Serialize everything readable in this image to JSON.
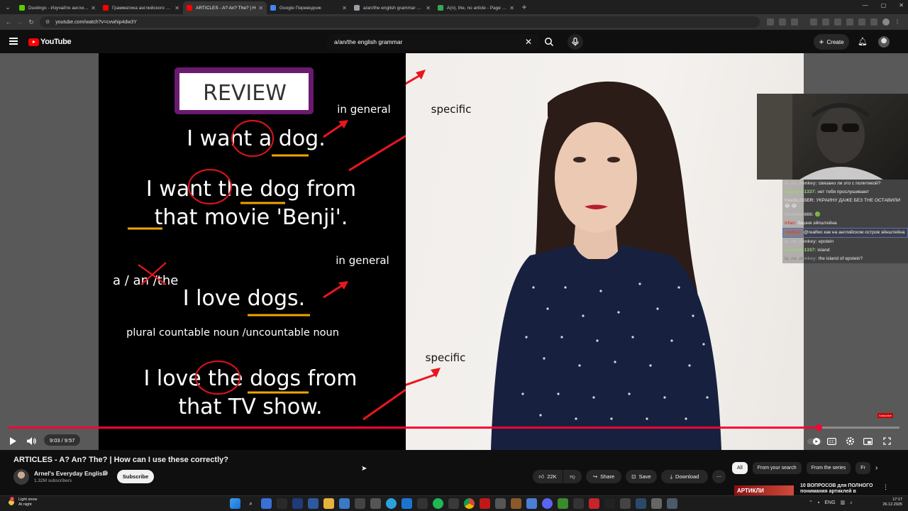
{
  "browser": {
    "tabs": [
      {
        "title": "Duolingo - Изучайте английск",
        "favicon_color": "#58cc02",
        "active": false
      },
      {
        "title": "Грамматика английского язы",
        "favicon_color": "#ff0000",
        "active": false
      },
      {
        "title": "ARTICLES - A? An? The? | H",
        "favicon_color": "#ff0000",
        "active": true
      },
      {
        "title": "Google Переводчик",
        "favicon_color": "#4285f4",
        "active": false
      },
      {
        "title": "a/an/the english grammar gam",
        "favicon_color": "#9aa0a6",
        "active": false
      },
      {
        "title": "A(n), the, no article - Page 3 of",
        "favicon_color": "#34a853",
        "active": false
      }
    ],
    "url": "youtube.com/watch?v=cvwhip4dw3Y"
  },
  "youtube": {
    "logo_text": "YouTube",
    "search_value": "a/an/the english grammar",
    "create_label": "Create"
  },
  "slide": {
    "review_title": "REVIEW",
    "sentence_1": "I want a dog.",
    "label_in_general_1": "in general",
    "label_specific_1": "specific",
    "sentence_2_line1": "I want the dog from",
    "sentence_2_line2": "that movie 'Benji'.",
    "a_an_the_prefix": "a / ",
    "a_an_the_struck": "an",
    "a_an_the_suffix": " /the",
    "label_in_general_2": "in general",
    "sentence_3": "I love dogs.",
    "noun_note": "plural countable noun /uncountable noun",
    "sentence_4_line1": "I love the dogs from",
    "sentence_4_line2": "that TV show.",
    "label_specific_2": "specific"
  },
  "overlay": {
    "chat": [
      {
        "user": "ia_ne_donkey:",
        "user_color": "#bfbfbf",
        "text": "связано ли это с политикой?",
        "highlight": false
      },
      {
        "user": "nudopac1337:",
        "user_color": "#9ad17a",
        "text": "нет тебя прослушивают",
        "highlight": false
      },
      {
        "user": "freeBLOGER:",
        "user_color": "#cfcfcf",
        "text": "УКРАИНУ ДАЖЕ БЕЗ THE ОСТАВИЛИ 😂 😂",
        "highlight": false
      },
      {
        "user": "threehell666:",
        "user_color": "#bfbfbf",
        "text": "🟢",
        "highlight": false
      },
      {
        "user": "irfan:",
        "user_color": "#d24a3a",
        "text": "башня эйпштейна",
        "highlight": false
      },
      {
        "user": "realfeo:",
        "user_color": "#d24a3a",
        "text": "@realfeo как на английском остров эйнштейна",
        "highlight": true
      },
      {
        "user": "ia_ne_donkey:",
        "user_color": "#bfbfbf",
        "text": "epstein",
        "highlight": false
      },
      {
        "user": "nudopac1337:",
        "user_color": "#9ad17a",
        "text": "island",
        "highlight": false
      },
      {
        "user": "ia_ne_donkey:",
        "user_color": "#8a8a8a",
        "text": "the island of epstein?",
        "highlight": false
      }
    ],
    "subscribe_badge": "Subscribe"
  },
  "player": {
    "time_current": "9:03",
    "time_total": "9:57",
    "time_text": "9:03 / 9:57",
    "progress_fraction": 0.909
  },
  "video": {
    "title": "ARTICLES - A? An? The? | How can I use these correctly?",
    "channel_name": "Arnel's Everyday English",
    "subscribers": "1.32M subscribers",
    "subscribe_label": "Subscribe",
    "likes": "22K",
    "share_label": "Share",
    "save_label": "Save",
    "download_label": "Download"
  },
  "recommendations": {
    "chips": [
      "All",
      "From your search",
      "From the series",
      "Fr"
    ],
    "first_title": "10 ВОПРОСОВ для ПОЛНОГО понимания артиклей в",
    "first_thumb_text": "АРТИКЛИ"
  },
  "taskbar": {
    "weather_line1": "Light snow",
    "weather_line2": "At night",
    "weather_badge": "2",
    "language": "ENG",
    "time": "17:17",
    "date": "26.12.2025"
  },
  "colors": {
    "accent_red": "#ff0033",
    "slide_frame_purple": "#6a1b6f",
    "underline_orange": "#f0a500",
    "circle_red": "#d0141b"
  }
}
